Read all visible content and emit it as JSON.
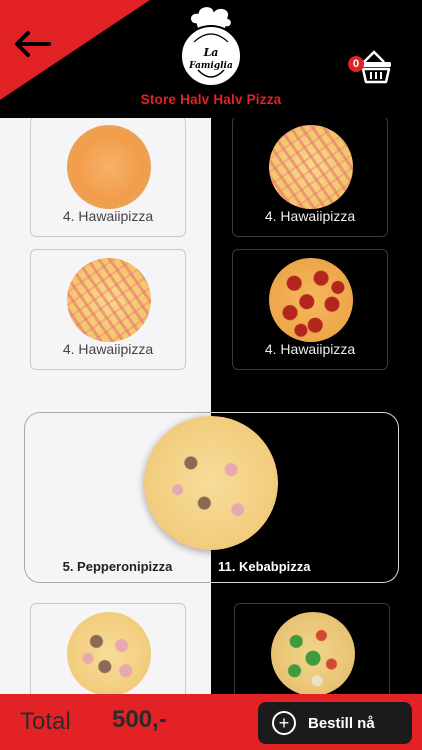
{
  "header": {
    "store_title": "Store Halv Halv Pizza",
    "logo_text_line1": "La",
    "logo_text_line2": "Famiglia",
    "cart_count": "0",
    "accent_color": "#e32226"
  },
  "pizzas": {
    "left": [
      {
        "label": "4. Hawaiipizza",
        "icon": "margherita"
      },
      {
        "label": "4. Hawaiipizza",
        "icon": "hawaii"
      },
      {
        "label": "",
        "icon": "kebab"
      }
    ],
    "right": [
      {
        "label": "4. Hawaiipizza",
        "icon": "hawaii"
      },
      {
        "label": "4. Hawaiipizza",
        "icon": "pepperoni"
      },
      {
        "label": "",
        "icon": "veggie"
      }
    ]
  },
  "selected": {
    "left_name": "5. Pepperonipizza",
    "right_name": "11. Kebabpizza"
  },
  "footer": {
    "total_label": "Total",
    "total_value": "500,-",
    "order_label": "Bestill nå"
  }
}
